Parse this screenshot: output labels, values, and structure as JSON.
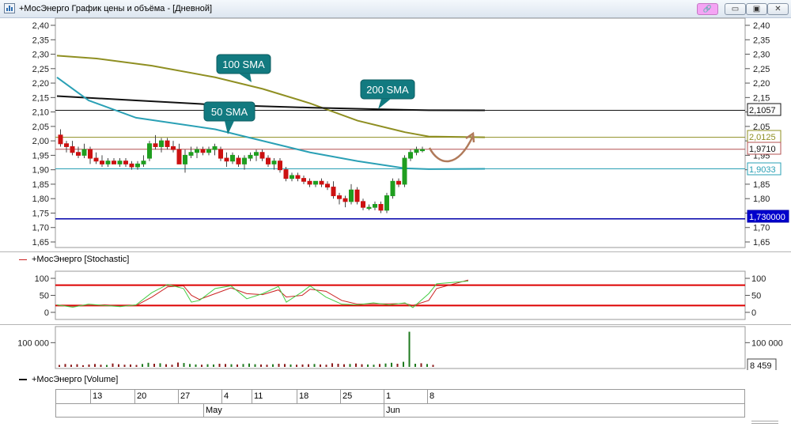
{
  "window": {
    "title": "+МосЭнерго График цены и объёма - [Дневной]",
    "buttons": {
      "link": "🔗",
      "minimize": "▭",
      "restore": "▣",
      "close": "✕"
    },
    "icon": "app-chart-icon"
  },
  "price_panel": {
    "annotations": {
      "sma100": "100 SMA",
      "sma200": "200 SMA",
      "sma50": "50 SMA"
    },
    "price_tags": {
      "sma200": "2,1057",
      "sma100": "2,0125",
      "last": "1,9710",
      "sma50": "1,9033",
      "horizontal": "1,730000"
    }
  },
  "stochastic_panel": {
    "legend": "+МосЭнерго [Stochastic]"
  },
  "volume_panel": {
    "legend": "+МосЭнерго [Volume]",
    "last_volume": "8 459"
  },
  "time_axis": {
    "days": [
      "13",
      "20",
      "27",
      "4",
      "11",
      "18",
      "25",
      "1",
      "8"
    ],
    "months": [
      "May",
      "Jun"
    ]
  },
  "colors": {
    "up": "#1f9e1f",
    "down": "#cc1111",
    "sma50": "#2aa0b5",
    "sma100": "#8f8f22",
    "sma200": "#111111",
    "level": "#0000aa",
    "last": "#b35050",
    "callout": "#127a80",
    "stoch_k": "#44cc44",
    "stoch_d": "#cc2222",
    "stoch_level": "#dd0000",
    "arrow": "#b07a5a"
  },
  "chart_data": [
    {
      "type": "candlestick",
      "yticks": [
        "2,40",
        "2,35",
        "2,30",
        "2,25",
        "2,20",
        "2,15",
        "2,10",
        "2,05",
        "2,00",
        "1,95",
        "1,90",
        "1,85",
        "1,80",
        "1,75",
        "1,70",
        "1,65"
      ],
      "ylim": [
        1.65,
        2.4
      ],
      "level": 1.73,
      "candles": [
        [
          2.02,
          2.04,
          1.98,
          1.99
        ],
        [
          1.99,
          2.0,
          1.96,
          1.98
        ],
        [
          1.98,
          2.0,
          1.95,
          1.96
        ],
        [
          1.96,
          1.98,
          1.94,
          1.95
        ],
        [
          1.95,
          1.99,
          1.94,
          1.97
        ],
        [
          1.97,
          1.98,
          1.92,
          1.94
        ],
        [
          1.94,
          1.96,
          1.92,
          1.93
        ],
        [
          1.93,
          1.95,
          1.91,
          1.92
        ],
        [
          1.92,
          1.94,
          1.91,
          1.93
        ],
        [
          1.93,
          1.94,
          1.92,
          1.92
        ],
        [
          1.92,
          1.94,
          1.91,
          1.93
        ],
        [
          1.93,
          1.94,
          1.91,
          1.92
        ],
        [
          1.92,
          1.93,
          1.9,
          1.91
        ],
        [
          1.91,
          1.93,
          1.9,
          1.92
        ],
        [
          1.92,
          1.95,
          1.91,
          1.93
        ],
        [
          1.94,
          2.0,
          1.93,
          1.99
        ],
        [
          1.99,
          2.02,
          1.97,
          1.98
        ],
        [
          1.98,
          2.01,
          1.96,
          2.0
        ],
        [
          2.0,
          2.01,
          1.97,
          1.98
        ],
        [
          1.98,
          2.0,
          1.96,
          1.97
        ],
        [
          1.97,
          1.99,
          1.92,
          1.92
        ],
        [
          1.92,
          1.97,
          1.89,
          1.95
        ],
        [
          1.95,
          1.98,
          1.94,
          1.96
        ],
        [
          1.96,
          1.98,
          1.94,
          1.97
        ],
        [
          1.97,
          1.98,
          1.95,
          1.96
        ],
        [
          1.96,
          1.98,
          1.95,
          1.97
        ],
        [
          1.97,
          1.99,
          1.95,
          1.98
        ],
        [
          1.97,
          1.98,
          1.93,
          1.94
        ],
        [
          1.94,
          1.96,
          1.91,
          1.93
        ],
        [
          1.93,
          1.96,
          1.92,
          1.95
        ],
        [
          1.94,
          1.95,
          1.91,
          1.92
        ],
        [
          1.92,
          1.95,
          1.9,
          1.94
        ],
        [
          1.94,
          1.96,
          1.93,
          1.95
        ],
        [
          1.95,
          1.97,
          1.93,
          1.96
        ],
        [
          1.96,
          1.97,
          1.93,
          1.94
        ],
        [
          1.94,
          1.95,
          1.91,
          1.92
        ],
        [
          1.92,
          1.94,
          1.9,
          1.93
        ],
        [
          1.93,
          1.94,
          1.89,
          1.9
        ],
        [
          1.9,
          1.91,
          1.86,
          1.87
        ],
        [
          1.87,
          1.89,
          1.86,
          1.88
        ],
        [
          1.88,
          1.89,
          1.86,
          1.87
        ],
        [
          1.87,
          1.88,
          1.85,
          1.86
        ],
        [
          1.86,
          1.87,
          1.84,
          1.85
        ],
        [
          1.85,
          1.86,
          1.84,
          1.86
        ],
        [
          1.86,
          1.87,
          1.84,
          1.85
        ],
        [
          1.85,
          1.86,
          1.83,
          1.84
        ],
        [
          1.84,
          1.86,
          1.8,
          1.81
        ],
        [
          1.81,
          1.82,
          1.78,
          1.8
        ],
        [
          1.8,
          1.81,
          1.77,
          1.79
        ],
        [
          1.79,
          1.85,
          1.78,
          1.83
        ],
        [
          1.83,
          1.84,
          1.78,
          1.79
        ],
        [
          1.79,
          1.8,
          1.76,
          1.77
        ],
        [
          1.77,
          1.78,
          1.76,
          1.77
        ],
        [
          1.77,
          1.79,
          1.76,
          1.78
        ],
        [
          1.78,
          1.79,
          1.75,
          1.76
        ],
        [
          1.76,
          1.82,
          1.75,
          1.81
        ],
        [
          1.81,
          1.87,
          1.8,
          1.86
        ],
        [
          1.86,
          1.87,
          1.84,
          1.85
        ],
        [
          1.85,
          1.95,
          1.84,
          1.94
        ],
        [
          1.94,
          1.97,
          1.93,
          1.96
        ],
        [
          1.96,
          1.98,
          1.95,
          1.97
        ],
        [
          1.97,
          1.98,
          1.96,
          1.97
        ]
      ],
      "sma50": [
        [
          0,
          2.22
        ],
        [
          40,
          2.14
        ],
        [
          100,
          2.08
        ],
        [
          200,
          2.04
        ],
        [
          260,
          2.0
        ],
        [
          320,
          1.96
        ],
        [
          380,
          1.93
        ],
        [
          440,
          1.905
        ],
        [
          470,
          1.902
        ],
        [
          541,
          1.9033
        ]
      ],
      "sma100": [
        [
          0,
          2.295
        ],
        [
          50,
          2.285
        ],
        [
          120,
          2.26
        ],
        [
          200,
          2.22
        ],
        [
          260,
          2.18
        ],
        [
          320,
          2.13
        ],
        [
          380,
          2.07
        ],
        [
          440,
          2.03
        ],
        [
          470,
          2.015
        ],
        [
          541,
          2.0125
        ]
      ],
      "sma200": [
        [
          0,
          2.155
        ],
        [
          100,
          2.14
        ],
        [
          200,
          2.125
        ],
        [
          320,
          2.115
        ],
        [
          400,
          2.11
        ],
        [
          470,
          2.106
        ],
        [
          541,
          2.1057
        ]
      ]
    },
    {
      "type": "line",
      "name": "Stochastic",
      "yticks": [
        "100",
        "50",
        "0"
      ],
      "ylim": [
        0,
        100
      ],
      "levels": [
        80,
        20
      ],
      "k": [
        [
          0,
          22
        ],
        [
          20,
          15
        ],
        [
          40,
          24
        ],
        [
          60,
          20
        ],
        [
          80,
          17
        ],
        [
          100,
          22
        ],
        [
          120,
          58
        ],
        [
          140,
          82
        ],
        [
          160,
          70
        ],
        [
          170,
          30
        ],
        [
          180,
          35
        ],
        [
          200,
          70
        ],
        [
          220,
          78
        ],
        [
          240,
          40
        ],
        [
          260,
          55
        ],
        [
          280,
          76
        ],
        [
          290,
          30
        ],
        [
          310,
          60
        ],
        [
          320,
          78
        ],
        [
          340,
          45
        ],
        [
          360,
          24
        ],
        [
          380,
          22
        ],
        [
          400,
          28
        ],
        [
          420,
          22
        ],
        [
          440,
          28
        ],
        [
          450,
          14
        ],
        [
          470,
          55
        ],
        [
          480,
          84
        ],
        [
          520,
          92
        ]
      ],
      "d": [
        [
          0,
          20
        ],
        [
          20,
          18
        ],
        [
          40,
          20
        ],
        [
          60,
          22
        ],
        [
          80,
          19
        ],
        [
          100,
          20
        ],
        [
          120,
          45
        ],
        [
          140,
          75
        ],
        [
          160,
          78
        ],
        [
          170,
          50
        ],
        [
          180,
          38
        ],
        [
          200,
          55
        ],
        [
          220,
          72
        ],
        [
          240,
          55
        ],
        [
          260,
          52
        ],
        [
          280,
          66
        ],
        [
          290,
          45
        ],
        [
          310,
          50
        ],
        [
          320,
          68
        ],
        [
          340,
          62
        ],
        [
          360,
          35
        ],
        [
          380,
          24
        ],
        [
          400,
          25
        ],
        [
          420,
          25
        ],
        [
          440,
          26
        ],
        [
          450,
          20
        ],
        [
          470,
          35
        ],
        [
          480,
          70
        ],
        [
          520,
          95
        ]
      ]
    },
    {
      "type": "bar",
      "name": "Volume",
      "yticks": [
        "100 000"
      ],
      "ylim": [
        0,
        150000
      ],
      "values": [
        8000,
        12000,
        9000,
        11000,
        7000,
        10000,
        12000,
        9000,
        8000,
        14000,
        11000,
        9000,
        10000,
        8000,
        12000,
        17000,
        13000,
        15000,
        11000,
        9000,
        18000,
        16000,
        12000,
        10000,
        9000,
        11000,
        10000,
        13000,
        12000,
        11000,
        10000,
        12000,
        14000,
        11000,
        10000,
        9000,
        11000,
        13000,
        12000,
        10000,
        9000,
        10000,
        11000,
        12000,
        10000,
        9000,
        15000,
        13000,
        11000,
        12000,
        14000,
        11000,
        10000,
        9000,
        12000,
        14000,
        17000,
        13000,
        21000,
        145000,
        13000,
        15000,
        12000,
        8459
      ],
      "colors_dn": [
        1,
        1,
        1,
        1,
        1,
        1,
        1,
        1,
        0,
        1,
        1,
        1,
        1,
        1,
        0,
        0,
        1,
        0,
        1,
        1,
        1,
        0,
        0,
        0,
        1,
        0,
        0,
        1,
        1,
        0,
        1,
        0,
        0,
        0,
        1,
        1,
        0,
        1,
        1,
        0,
        1,
        1,
        1,
        0,
        1,
        1,
        1,
        1,
        1,
        0,
        1,
        1,
        0,
        0,
        1,
        0,
        0,
        1,
        0,
        0,
        0,
        1,
        0,
        1
      ]
    }
  ]
}
